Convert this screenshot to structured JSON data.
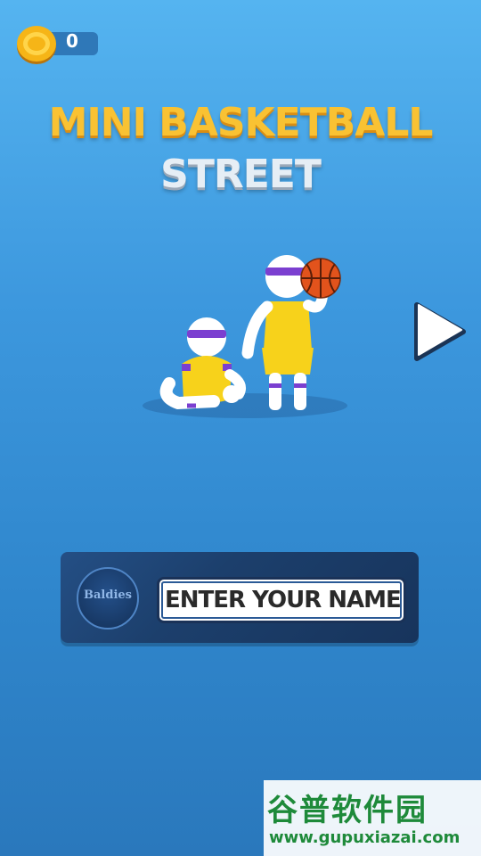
{
  "hud": {
    "coins": "0",
    "coin_icon": "gold-coin-icon"
  },
  "title": {
    "line1": "MINI BASKETBALL",
    "line2": "STREET"
  },
  "characters": {
    "icons": [
      "sitting-player-icon",
      "standing-player-icon",
      "basketball-icon"
    ]
  },
  "next": {
    "icon": "play-triangle-icon"
  },
  "name_entry": {
    "logo_text": "Baldies",
    "placeholder": "ENTER YOUR NAME",
    "value": ""
  },
  "watermark": {
    "cn": "谷普软件园",
    "url": "www.gupuxiazai.com"
  },
  "colors": {
    "sky_top": "#55b4f0",
    "sky_bottom": "#2a78bc",
    "title_gold": "#f9c233",
    "title_silver": "#e6eef5",
    "panel": "#1c3f6c",
    "jersey": "#f7d21b",
    "headband": "#7b3fd0",
    "ball": "#e2531c"
  }
}
